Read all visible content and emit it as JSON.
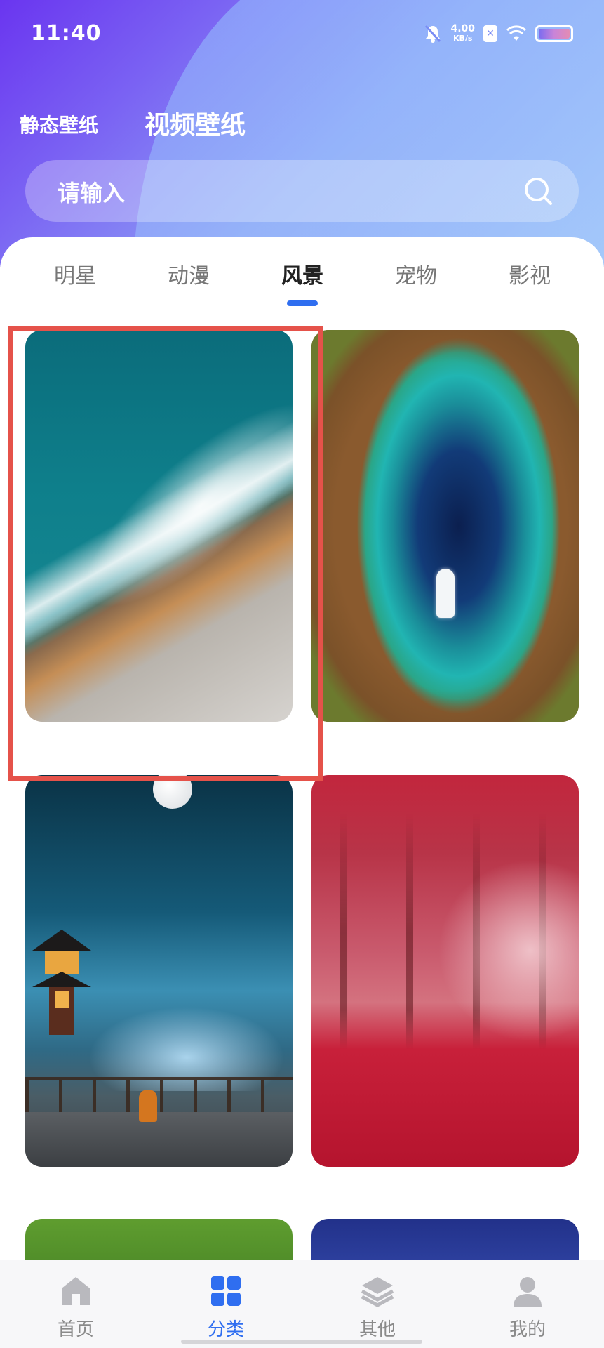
{
  "status_bar": {
    "time": "11:40",
    "net_speed_value": "4.00",
    "net_speed_unit": "KB/s",
    "sim_badge": "✕",
    "icons": [
      "mute-bell-icon",
      "sim-x-icon",
      "wifi-icon",
      "battery-icon"
    ]
  },
  "top_tabs": {
    "static_label": "静态壁纸",
    "video_label": "视频壁纸",
    "active": "视频壁纸"
  },
  "search": {
    "placeholder": "请输入",
    "icon": "search-icon"
  },
  "categories": {
    "items": [
      "明星",
      "动漫",
      "风景",
      "宠物",
      "影视"
    ],
    "active": "风景",
    "indicator_color": "#2f6ef0"
  },
  "grid": {
    "tiles": [
      {
        "subject": "ocean-waves-rocky-shore"
      },
      {
        "subject": "blue-lagoon-boat"
      },
      {
        "subject": "pagoda-moon-night"
      },
      {
        "subject": "red-autumn-forest"
      },
      {
        "subject": "green-foliage"
      },
      {
        "subject": "deep-blue-sea"
      }
    ],
    "selected_index": 0,
    "selection_color": "#e5524a"
  },
  "bottom_nav": {
    "items": [
      {
        "label": "首页",
        "icon": "home-icon"
      },
      {
        "label": "分类",
        "icon": "grid-icon"
      },
      {
        "label": "其他",
        "icon": "layers-icon"
      },
      {
        "label": "我的",
        "icon": "user-icon"
      }
    ],
    "active": "分类",
    "active_color": "#2f6ef0",
    "inactive_color": "#8a8a8a"
  }
}
